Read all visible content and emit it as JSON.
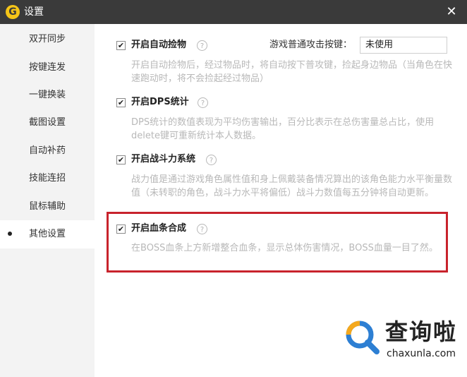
{
  "window": {
    "title": "设置",
    "logo_letter": "G"
  },
  "sidebar": {
    "items": [
      {
        "label": "双开同步"
      },
      {
        "label": "按键连发"
      },
      {
        "label": "一键换装"
      },
      {
        "label": "截图设置"
      },
      {
        "label": "自动补药"
      },
      {
        "label": "技能连招"
      },
      {
        "label": "鼠标辅助"
      },
      {
        "label": "其他设置",
        "active": true
      }
    ]
  },
  "sections": [
    {
      "title": "开启自动捡物",
      "checked": true,
      "description": "开启自动捡物后，经过物品时，将自动按下普攻键，捡起身边物品（当角色在快速跑动时，将不会捡起经过物品）",
      "hotkey": {
        "label": "游戏普通攻击按键：",
        "value": "未使用"
      }
    },
    {
      "title": "开启DPS统计",
      "checked": true,
      "description": "DPS统计的数值表现为平均伤害输出，百分比表示在总伤害量总占比，使用delete键可重新统计本人数据。"
    },
    {
      "title": "开启战斗力系统",
      "checked": true,
      "description": "战力值是通过游戏角色属性值和身上佩戴装备情况算出的该角色能力水平衡量数值（未转职的角色，战斗力水平将偏低）战斗力数值每五分钟将自动更新。"
    },
    {
      "title": "开启血条合成",
      "checked": true,
      "description": "在BOSS血条上方新增整合血条，显示总体伤害情况，BOSS血量一目了然。"
    }
  ],
  "icons": {
    "check": "✔",
    "help": "?",
    "close": "✕"
  },
  "colors": {
    "titlebar": "#3a3a3a",
    "highlight": "#c8232c",
    "description": "#b8b8b8",
    "logo": "#f5c518"
  },
  "watermark": {
    "text_cn": "查询啦",
    "text_en": "chaxunla.com"
  }
}
